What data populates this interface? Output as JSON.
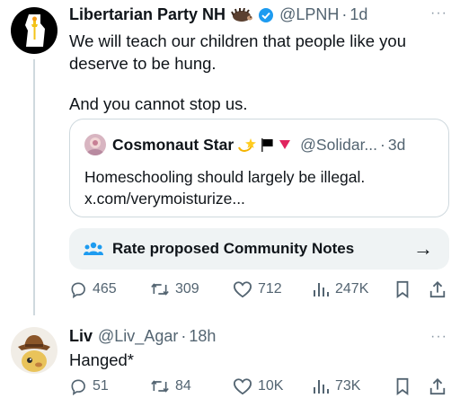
{
  "tweet1": {
    "display_name": "Libertarian Party NH",
    "handle": "@LPNH",
    "separator": "·",
    "time": "1d",
    "text_line1": "We will teach our children that people like you",
    "text_line2": "deserve to be hung.",
    "text_line3": "And you cannot stop us.",
    "quote": {
      "display_name": "Cosmonaut Star",
      "handle": "@Solidar...",
      "separator": "·",
      "time": "3d",
      "text_line1": "Homeschooling should largely be illegal.",
      "text_line2": "x.com/verymoisturize..."
    },
    "community_notes_label": "Rate proposed Community Notes",
    "community_notes_arrow": "→",
    "actions": {
      "replies": "465",
      "reposts": "309",
      "likes": "712",
      "views": "247K"
    }
  },
  "tweet2": {
    "display_name": "Liv",
    "handle": "@Liv_Agar",
    "separator": "·",
    "time": "18h",
    "text": "Hanged*",
    "actions": {
      "replies": "51",
      "reposts": "84",
      "likes": "10K",
      "views": "73K"
    }
  },
  "more_glyph": "···",
  "colors": {
    "text": "#0f1419",
    "secondary": "#536471",
    "border": "#cfd9de",
    "verified": "#1d9bf0",
    "notes_bg": "#eff3f4"
  },
  "icons": [
    "reply-icon",
    "repost-icon",
    "like-icon",
    "views-icon",
    "bookmark-icon",
    "share-icon",
    "verified-badge-icon",
    "people-icon",
    "arrow-right-icon"
  ]
}
